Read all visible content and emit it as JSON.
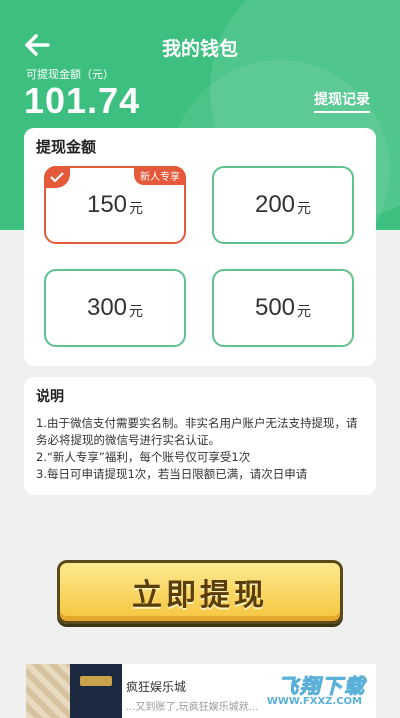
{
  "header": {
    "title": "我的钱包",
    "balance_label": "可提现金额（元）",
    "balance_value": "101.74",
    "record_link": "提现记录"
  },
  "amount_section": {
    "title": "提现金额",
    "unit": "元",
    "options": [
      {
        "value": "150",
        "badge": "新人专享",
        "selected": true
      },
      {
        "value": "200"
      },
      {
        "value": "300"
      },
      {
        "value": "500"
      }
    ]
  },
  "info": {
    "title": "说明",
    "lines": [
      "1.由于微信支付需要实名制。非实名用户账户无法支持提现，请务必将提现的微信号进行实名认证。",
      "2.“新人专享”福利，每个账号仅可享受1次",
      "3.每日可申请提现1次，若当日限额已满，请次日申请"
    ]
  },
  "submit_label": "立即提现",
  "ad": {
    "title": "疯狂娱乐城",
    "description": "...又到账了,玩疯狂娱乐城就...",
    "watermark": "飞翔下载",
    "watermark_sub": "WWW.FXXZ.COM"
  },
  "colors": {
    "primary_green": "#3dbf7f",
    "selected_red": "#e4593a",
    "button_yellow": "#f6c53e"
  }
}
